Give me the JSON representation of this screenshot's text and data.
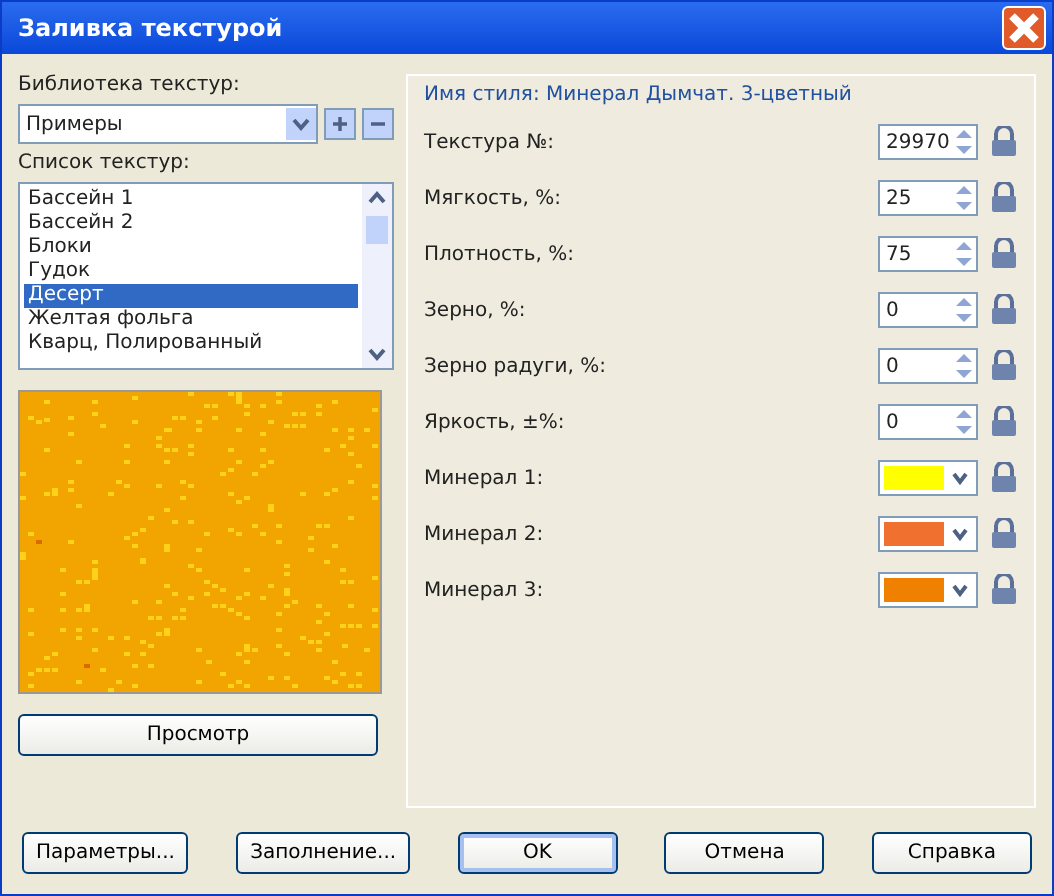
{
  "window": {
    "title": "Заливка текстурой"
  },
  "library": {
    "label": "Библиотека текстур:",
    "value": "Примеры"
  },
  "texture_list": {
    "label": "Список текстур:",
    "items": [
      {
        "label": "Бассейн 1",
        "selected": false
      },
      {
        "label": "Бассейн 2",
        "selected": false
      },
      {
        "label": "Блоки",
        "selected": false
      },
      {
        "label": "Гудок",
        "selected": false
      },
      {
        "label": "Десерт",
        "selected": true
      },
      {
        "label": "Желтая фольга",
        "selected": false
      },
      {
        "label": "Кварц, Полированный",
        "selected": false
      }
    ]
  },
  "preview_button": "Просмотр",
  "style_name": "Имя стиля: Минерал Дымчат. 3-цветный",
  "params": [
    {
      "kind": "number",
      "label": "Текстура №:",
      "value": "29970"
    },
    {
      "kind": "number",
      "label": "Мягкость, %:",
      "value": "25"
    },
    {
      "kind": "number",
      "label": "Плотность, %:",
      "value": "75"
    },
    {
      "kind": "number",
      "label": "Зерно, %:",
      "value": "0"
    },
    {
      "kind": "number",
      "label": "Зерно радуги, %:",
      "value": "0"
    },
    {
      "kind": "number",
      "label": "Яркость, ±%:",
      "value": "0"
    },
    {
      "kind": "color",
      "label": "Минерал 1:",
      "color": "#ffff00"
    },
    {
      "kind": "color",
      "label": "Минерал 2:",
      "color": "#f07030"
    },
    {
      "kind": "color",
      "label": "Минерал 3:",
      "color": "#f08000"
    }
  ],
  "buttons": [
    {
      "label": "Параметры...",
      "default": false
    },
    {
      "label": "Заполнение...",
      "default": false
    },
    {
      "label": "OK",
      "default": true
    },
    {
      "label": "Отмена",
      "default": false
    },
    {
      "label": "Справка",
      "default": false
    }
  ]
}
